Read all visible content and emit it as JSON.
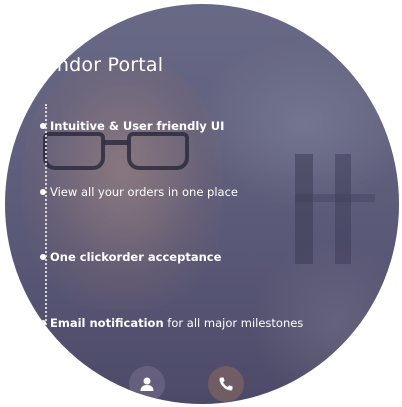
{
  "portal": {
    "title": "endor Portal"
  },
  "features": [
    {
      "strong": "Intuitive & User friendly UI",
      "rest": ""
    },
    {
      "strong": "",
      "rest": "View all your orders in one place"
    },
    {
      "strong": "One clickorder acceptance",
      "rest": ""
    },
    {
      "strong": "Email notification",
      "rest": " for all major milestones"
    }
  ],
  "icons": {
    "person": "person-icon",
    "phone": "phone-icon"
  },
  "colors": {
    "overlay": "#4a4a7a",
    "phone_button": "#7a5f64",
    "text": "#ffffff"
  }
}
